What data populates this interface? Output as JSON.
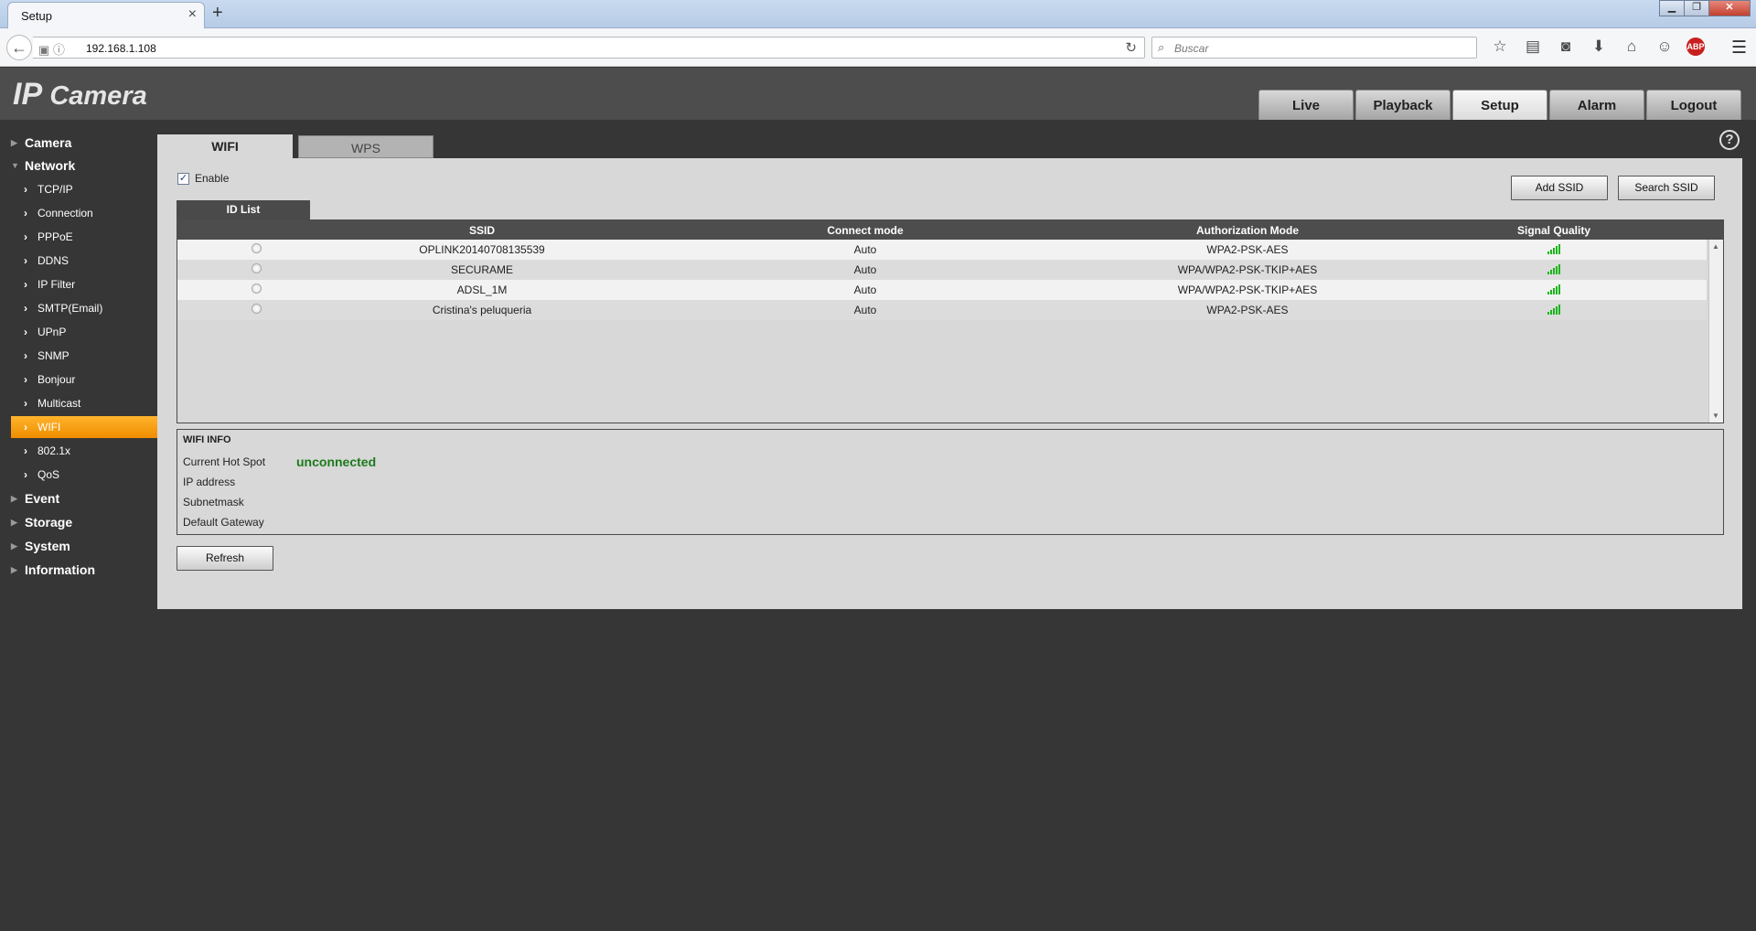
{
  "browser": {
    "tab_title": "Setup",
    "tab_close": "×",
    "new_tab": "+",
    "url": "192.168.1.108",
    "search_placeholder": "Buscar",
    "abp_label": "ABP"
  },
  "app": {
    "logo_ip": "IP",
    "logo_camera": "Camera",
    "top_tabs": [
      "Live",
      "Playback",
      "Setup",
      "Alarm",
      "Logout"
    ],
    "active_top_tab": "Setup"
  },
  "sidebar": {
    "camera": "Camera",
    "network": "Network",
    "network_items": [
      "TCP/IP",
      "Connection",
      "PPPoE",
      "DDNS",
      "IP Filter",
      "SMTP(Email)",
      "UPnP",
      "SNMP",
      "Bonjour",
      "Multicast",
      "WIFI",
      "802.1x",
      "QoS"
    ],
    "active_item": "WIFI",
    "event": "Event",
    "storage": "Storage",
    "system": "System",
    "information": "Information"
  },
  "panel": {
    "tabs": [
      "WIFI",
      "WPS"
    ],
    "help": "?",
    "enable_label": "Enable",
    "enable_checked": true,
    "add_ssid": "Add SSID",
    "search_ssid": "Search SSID",
    "id_list_tab": "ID List",
    "table": {
      "headers": [
        "SSID",
        "Connect mode",
        "Authorization Mode",
        "Signal Quality"
      ],
      "rows": [
        {
          "ssid": "OPLINK20140708135539",
          "mode": "Auto",
          "auth": "WPA2-PSK-AES",
          "signal": "full"
        },
        {
          "ssid": "SECURAME",
          "mode": "Auto",
          "auth": "WPA/WPA2-PSK-TKIP+AES",
          "signal": "full"
        },
        {
          "ssid": "ADSL_1M",
          "mode": "Auto",
          "auth": "WPA/WPA2-PSK-TKIP+AES",
          "signal": "full"
        },
        {
          "ssid": "Cristina's peluqueria",
          "mode": "Auto",
          "auth": "WPA2-PSK-AES",
          "signal": "full"
        }
      ]
    },
    "wifi_info": {
      "title": "WIFI INFO",
      "current_hot_spot_label": "Current Hot Spot",
      "current_hot_spot_value": "unconnected",
      "ip_label": "IP address",
      "subnet_label": "Subnetmask",
      "gateway_label": "Default Gateway"
    },
    "refresh": "Refresh"
  },
  "colors": {
    "accent_active_item": "#f5a000",
    "status_unconnected": "#1c7a1c",
    "signal_green": "#1bb51b"
  }
}
